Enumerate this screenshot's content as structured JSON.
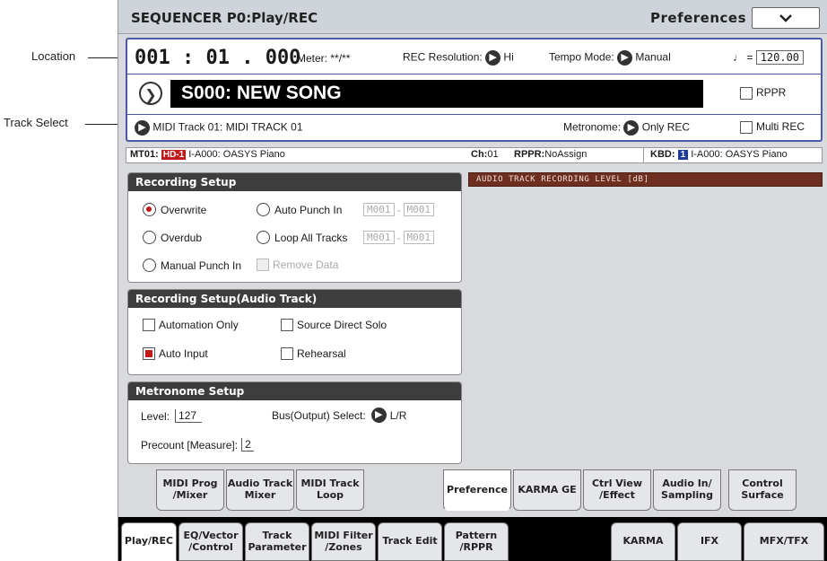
{
  "callouts": {
    "location": "Location",
    "track_select": "Track Select"
  },
  "titlebar": {
    "title": "SEQUENCER P0:Play/REC",
    "page": "Preferences",
    "menu_icon": "chevron-down-icon"
  },
  "info": {
    "location": "001 : 01 . 000",
    "meter_label": "Meter:",
    "meter_value": "**/**",
    "rec_res_label": "REC Resolution:",
    "rec_res_value": "Hi",
    "tempo_mode_label": "Tempo Mode:",
    "tempo_mode_value": "Manual",
    "tempo_symbol": "♩ =",
    "tempo_value": "120.00",
    "song_name": "S000: NEW SONG",
    "rppr_label": "RPPR",
    "track_select": "MIDI Track 01: MIDI TRACK 01",
    "metronome_label": "Metronome:",
    "metronome_value": "Only REC",
    "multi_rec_label": "Multi REC"
  },
  "status": {
    "track": "MT01:",
    "hd": "HD-1",
    "program": "I-A000: OASYS Piano",
    "ch_label": "Ch:",
    "ch_value": "01",
    "rppr_label": "RPPR:",
    "rppr_value": "NoAssign",
    "kbd_label": "KBD:",
    "kbd_num": "1",
    "kbd_program": "I-A000: OASYS Piano"
  },
  "recording_setup": {
    "title": "Recording Setup",
    "overwrite": "Overwrite",
    "overdub": "Overdub",
    "manual_punch": "Manual Punch In",
    "auto_punch": "Auto Punch In",
    "loop_all": "Loop All Tracks",
    "remove_data": "Remove Data",
    "m_start": "M001",
    "m_end": "M001",
    "dash": "-"
  },
  "audio_setup": {
    "title": "Recording Setup(Audio Track)",
    "automation_only": "Automation Only",
    "source_direct_solo": "Source Direct Solo",
    "auto_input": "Auto Input",
    "rehearsal": "Rehearsal"
  },
  "metronome_setup": {
    "title": "Metronome Setup",
    "level_label": "Level:",
    "level_value": "127",
    "bus_label": "Bus(Output) Select:",
    "bus_value": "L/R",
    "precount_label": "Precount [Measure]:",
    "precount_value": "2"
  },
  "meter_panel": {
    "label": "AUDIO TRACK RECORDING LEVEL [dB]"
  },
  "upper_tabs": [
    {
      "label": "MIDI Prog /Mixer"
    },
    {
      "label": "Audio Track Mixer"
    },
    {
      "label": "MIDI Track Loop"
    },
    {
      "label": "Preference"
    },
    {
      "label": "KARMA GE"
    },
    {
      "label": "Ctrl View /Effect"
    },
    {
      "label": "Audio In/ Sampling"
    },
    {
      "label": "Control Surface"
    }
  ],
  "lower_tabs": [
    {
      "label": "Play/REC"
    },
    {
      "label": "EQ/Vector /Control"
    },
    {
      "label": "Track Parameter"
    },
    {
      "label": "MIDI Filter /Zones"
    },
    {
      "label": "Track Edit"
    },
    {
      "label": "Pattern /RPPR"
    },
    {
      "label": "KARMA"
    },
    {
      "label": "IFX"
    },
    {
      "label": "MFX/TFX"
    }
  ]
}
